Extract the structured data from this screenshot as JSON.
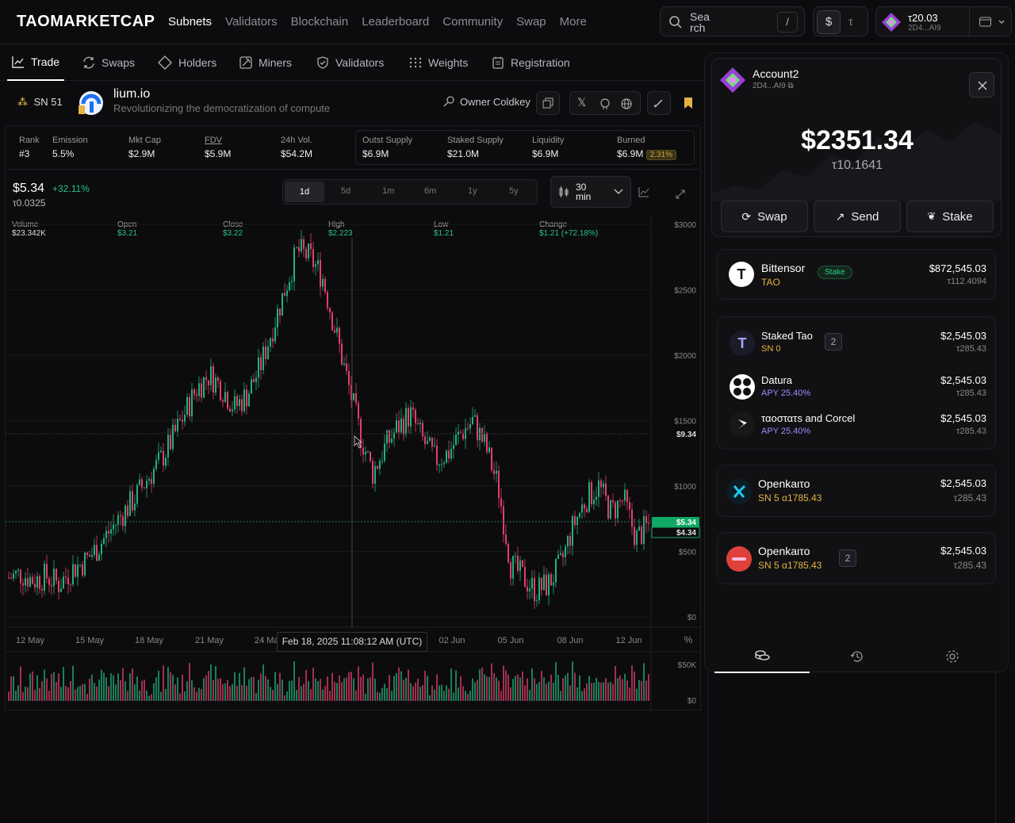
{
  "brand": {
    "logo": "TAOMARKETCAP"
  },
  "nav": {
    "items": [
      "Subnets",
      "Validators",
      "Blockchain",
      "Leaderboard",
      "Community",
      "Swap",
      "More"
    ]
  },
  "search": {
    "placeholder": "Search",
    "label": "Sea rch",
    "shortcut": "/"
  },
  "currency": {
    "usd": "$",
    "tao": "τ"
  },
  "wallet": {
    "balance": "τ20.03",
    "address": "2D4...AI9"
  },
  "subnav": {
    "tabs": [
      "Trade",
      "Swaps",
      "Holders",
      "Miners",
      "Validators",
      "Weights",
      "Registration"
    ]
  },
  "subnet": {
    "sn": "SN 51",
    "name": "lium.io",
    "desc": "Revolutionizing the democratization of compute",
    "owner_label": "Owner Coldkey"
  },
  "stats": [
    {
      "k": "Rank",
      "v": "#3"
    },
    {
      "k": "Emission",
      "v": "5.5%"
    },
    {
      "k": "Mkt Cap",
      "v": "$2.9M"
    },
    {
      "k": "FDV",
      "v": "$5.9M"
    },
    {
      "k": "24h Vol.",
      "v": "$54.2M"
    },
    {
      "k": "Outst Supply",
      "v": "$6.9M"
    },
    {
      "k": "Staked Supply",
      "v": "$21.0M"
    },
    {
      "k": "Liquidity",
      "v": "$6.9M"
    },
    {
      "k": "Burned",
      "v": "$6.9M",
      "badge": "2.31%"
    }
  ],
  "price": {
    "usd": "$5.34",
    "change": "+32.11%",
    "tao": "τ0.0325"
  },
  "ranges": [
    "1d",
    "5d",
    "1m",
    "6m",
    "1y",
    "5y"
  ],
  "interval": {
    "label": "30 min"
  },
  "ohlc": [
    {
      "k": "Volume",
      "v": "$23.342K"
    },
    {
      "k": "Open",
      "v": "$3.21"
    },
    {
      "k": "Close",
      "v": "$3.22"
    },
    {
      "k": "High",
      "v": "$2.223"
    },
    {
      "k": "Low",
      "v": "$1.21"
    },
    {
      "k": "Change",
      "v": "$1.21 (+72.18%)"
    }
  ],
  "chart_data": {
    "type": "candlestick",
    "yaxis_ticks": [
      "$3000",
      "$2500",
      "$2000",
      "$1500",
      "$1000",
      "$500",
      "$0"
    ],
    "xaxis_ticks": [
      "12 May",
      "15 May",
      "18 May",
      "21 May",
      "24 May",
      "02 Jun",
      "05 Jun",
      "08 Jun",
      "12 Jun"
    ],
    "price_markers": [
      "$9.34",
      "$5.34",
      "$4.34"
    ],
    "volume_ticks": [
      "$50K",
      "$0"
    ],
    "close_series": [
      300,
      330,
      280,
      310,
      250,
      360,
      420,
      520,
      650,
      780,
      900,
      1050,
      1180,
      1350,
      1550,
      1750,
      1850,
      1750,
      1600,
      1700,
      1900,
      2200,
      2500,
      2800,
      2750,
      2600,
      2200,
      1800,
      1400,
      1100,
      1300,
      1450,
      1550,
      1350,
      1200,
      1250,
      1400,
      1500,
      1300,
      1000,
      400,
      300,
      200,
      250,
      400,
      700,
      900,
      1000,
      800,
      900,
      600,
      700
    ],
    "crosshair_time": "Feb 18, 2025 11:08:12 AM (UTC)",
    "percent_toggle": "%",
    "colors": {
      "up": "#22b07a",
      "down": "#e2406a",
      "grid": "#17171a"
    }
  },
  "account": {
    "name": "Account2",
    "addr": "2D4...AI9",
    "usd": "$2351.34",
    "tao": "τ10.1641",
    "buttons": [
      "Swap",
      "Send",
      "Stake"
    ]
  },
  "holdings": [
    {
      "name": "Bittensor",
      "sub": "TAO",
      "badge": "Stake",
      "usd": "$872,545.03",
      "tao": "τ112.4094"
    },
    {
      "name": "Staked Tao",
      "sub": "SN 0",
      "count": "2",
      "usd": "$2,545.03",
      "tao": "τ285.43"
    },
    {
      "name": "Datura",
      "sub": "APY 25.40%",
      "usd": "$2,545.03",
      "tao": "τ285.43"
    },
    {
      "name": "ταοστατs and Corcel",
      "sub": "APY 25.40%",
      "usd": "$2,545.03",
      "tao": "τ285.43"
    },
    {
      "name": "Openkaιτo",
      "sub": "SN 5",
      "sub2": "α1785.43",
      "usd": "$2,545.03",
      "tao": "τ285.43"
    },
    {
      "name": "Openkaιτo",
      "sub": "SN 5",
      "sub2": "α1785.43",
      "count": "2",
      "usd": "$2,545.03",
      "tao": "τ285.43"
    }
  ]
}
